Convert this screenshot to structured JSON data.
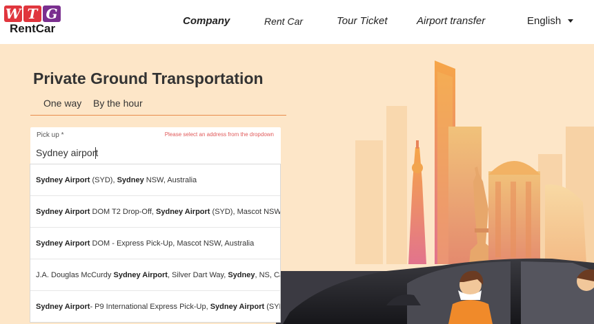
{
  "brand": {
    "letters": [
      "W",
      "T",
      "G"
    ],
    "letter_colors": [
      "#e0353d",
      "#e0353d",
      "#7a2f8f"
    ],
    "name": "RentCar"
  },
  "nav": {
    "company": "Company",
    "rent_car": "Rent Car",
    "tour_ticket": "Tour Ticket",
    "airport_transfer": "Airport transfer",
    "language": "English"
  },
  "page": {
    "title": "Private Ground Transportation",
    "tabs": [
      "One way",
      "By the hour"
    ],
    "accent_color": "#e98a4a"
  },
  "pickup": {
    "label": "Pick up *",
    "error": "Please select an address from the dropdown",
    "value": "Sydney airport"
  },
  "suggestions": [
    [
      {
        "t": "Sydney Airport",
        "b": true
      },
      {
        "t": " (SYD), ",
        "b": false
      },
      {
        "t": "Sydney",
        "b": true
      },
      {
        "t": " NSW, Australia",
        "b": false
      }
    ],
    [
      {
        "t": "Sydney Airport",
        "b": true
      },
      {
        "t": " DOM T2 Drop-Off, ",
        "b": false
      },
      {
        "t": "Sydney Airport",
        "b": true
      },
      {
        "t": " (SYD), Mascot NSW, Australia",
        "b": false
      }
    ],
    [
      {
        "t": "Sydney Airport",
        "b": true
      },
      {
        "t": " DOM - Express Pick-Up, Mascot NSW, Australia",
        "b": false
      }
    ],
    [
      {
        "t": "J.A. Douglas McCurdy ",
        "b": false
      },
      {
        "t": "Sydney Airport",
        "b": true
      },
      {
        "t": ", Silver Dart Way, ",
        "b": false
      },
      {
        "t": "Sydney",
        "b": true
      },
      {
        "t": ", NS, Canada",
        "b": false
      }
    ],
    [
      {
        "t": "Sydney Airport",
        "b": true
      },
      {
        "t": "- P9 International Express Pick-Up, ",
        "b": false
      },
      {
        "t": "Sydney Airport",
        "b": true
      },
      {
        "t": " (SYD), Mascot NSW, Australia",
        "b": false
      }
    ]
  ]
}
